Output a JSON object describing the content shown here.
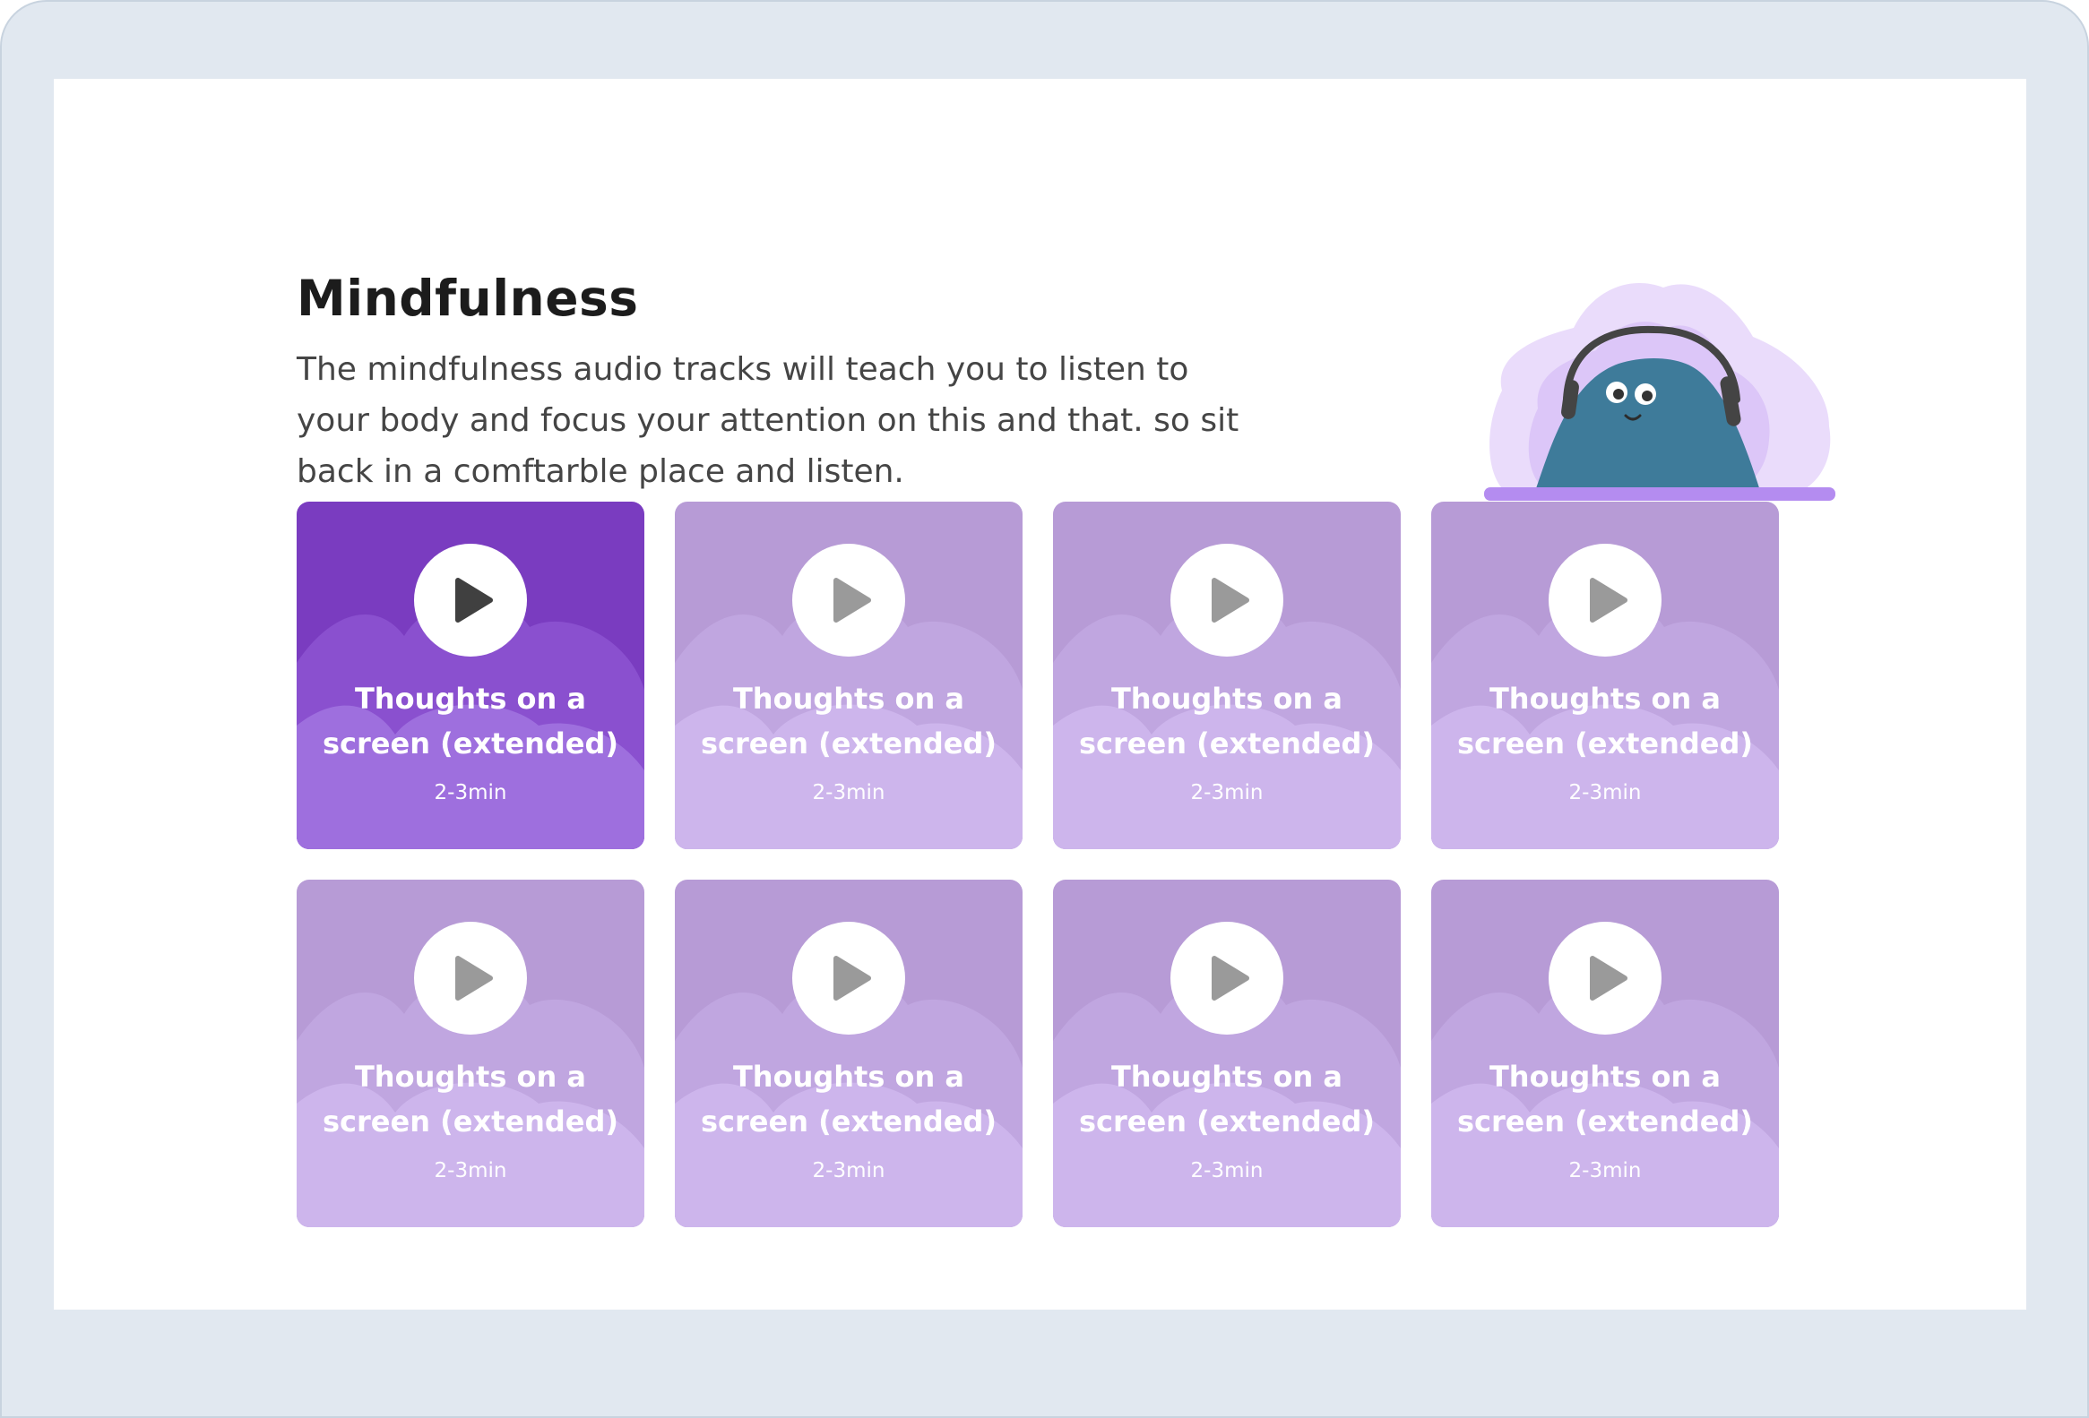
{
  "page": {
    "title": "Mindfulness",
    "description": "The mindfulness audio tracks will teach you to listen to your body and focus your attention on this and that. so sit back in a comftarble place and listen."
  },
  "colors": {
    "active_card_base": "#7a3cc0",
    "active_card_blob": "#9e6fde",
    "inactive_card_base": "#b79bd6",
    "inactive_card_blob": "#cdb5ec",
    "play_icon_active": "#404040",
    "play_icon_inactive": "#9a9a9a",
    "mascot_body": "#3e7b9a",
    "mascot_aura": "#e2d2fa",
    "mascot_base": "#b48cf0"
  },
  "tracks": [
    {
      "title": "Thoughts on a screen (extended)",
      "duration": "2-3min",
      "active": true
    },
    {
      "title": "Thoughts on a screen (extended)",
      "duration": "2-3min",
      "active": false
    },
    {
      "title": "Thoughts on a screen (extended)",
      "duration": "2-3min",
      "active": false
    },
    {
      "title": "Thoughts on a screen (extended)",
      "duration": "2-3min",
      "active": false
    },
    {
      "title": "Thoughts on a screen (extended)",
      "duration": "2-3min",
      "active": false
    },
    {
      "title": "Thoughts on a screen (extended)",
      "duration": "2-3min",
      "active": false
    },
    {
      "title": "Thoughts on a screen (extended)",
      "duration": "2-3min",
      "active": false
    },
    {
      "title": "Thoughts on a screen (extended)",
      "duration": "2-3min",
      "active": false
    }
  ],
  "icons": {
    "play": "play-icon",
    "mascot": "headphones-mascot-illustration"
  }
}
